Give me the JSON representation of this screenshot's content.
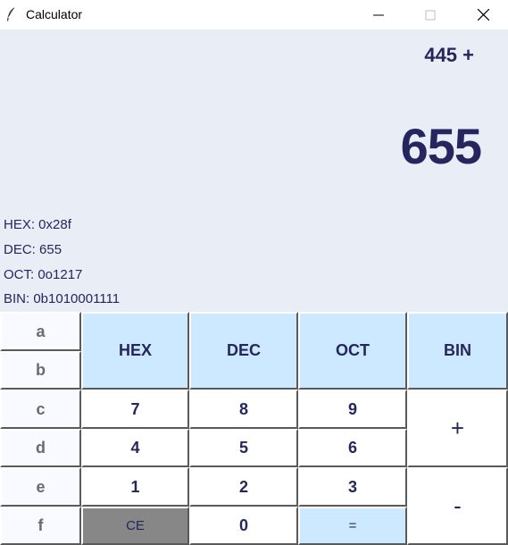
{
  "window": {
    "title": "Calculator",
    "icon": "feather-icon",
    "controls": [
      "minimize-icon",
      "maximize-icon",
      "close-icon"
    ]
  },
  "display": {
    "expression": "445 +",
    "result": "655",
    "conversions": {
      "hex": "HEX: 0x28f",
      "dec": "DEC: 655",
      "oct": "OCT: 0o1217",
      "bin": "BIN: 0b1010001111"
    }
  },
  "keys": {
    "hex_letters": [
      "a",
      "b",
      "c",
      "d",
      "e",
      "f"
    ],
    "bases": [
      "HEX",
      "DEC",
      "OCT",
      "BIN"
    ],
    "digits": [
      "7",
      "8",
      "9",
      "4",
      "5",
      "6",
      "1",
      "2",
      "3",
      "0"
    ],
    "plus": "+",
    "minus": "-",
    "clear": "CE",
    "equals": "="
  },
  "colors": {
    "display_bg": "#e9edf5",
    "text": "#25265e",
    "base_key_bg": "#cce9ff",
    "clear_key_bg": "#878787"
  }
}
